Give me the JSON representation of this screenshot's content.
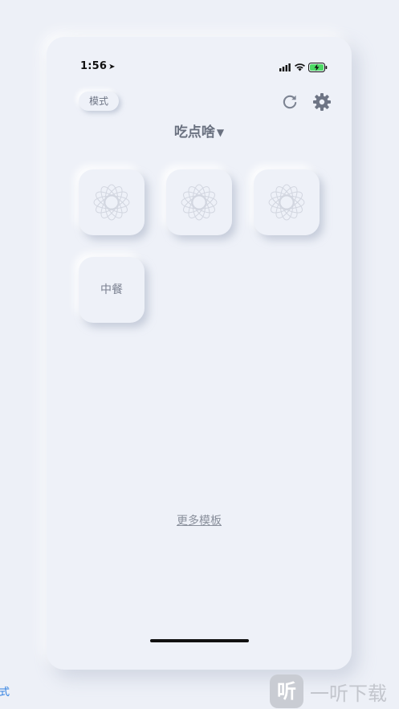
{
  "status_bar": {
    "time": "1:56",
    "location_icon": "location-arrow-icon",
    "signal_icon": "cellular-signal-icon",
    "wifi_icon": "wifi-icon",
    "battery_icon": "battery-charging-icon"
  },
  "header": {
    "mode_label": "模式",
    "refresh_icon": "refresh-icon",
    "settings_icon": "gear-icon"
  },
  "title": {
    "text": "吃点啥",
    "caret": "▼"
  },
  "tiles": [
    {
      "label": "",
      "icon": "spirograph-flower-icon"
    },
    {
      "label": "",
      "icon": "spirograph-flower-icon"
    },
    {
      "label": "",
      "icon": "spirograph-flower-icon"
    },
    {
      "label": "中餐",
      "icon": ""
    }
  ],
  "footer": {
    "more_templates": "更多模板"
  },
  "edge_text": "式",
  "watermark": {
    "logo": "听",
    "text": "一听下载"
  },
  "colors": {
    "background": "#edf0f7",
    "surface": "#eef1f8",
    "text_muted": "#6a7180",
    "link_blue": "#2f7fe0"
  }
}
